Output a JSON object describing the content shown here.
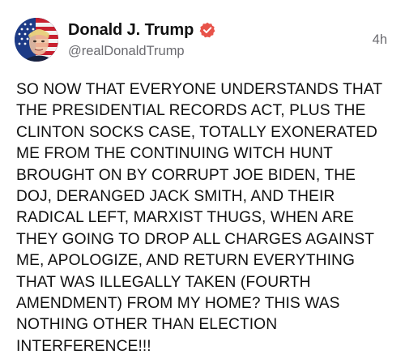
{
  "author": {
    "display_name": "Donald J. Trump",
    "handle": "@realDonaldTrump",
    "verified": true,
    "avatar_icon": "flag-portrait-avatar"
  },
  "timestamp": "4h",
  "post": {
    "lines": [
      "SO NOW THAT EVERYONE UNDERSTANDS THAT",
      "THE PRESIDENTIAL RECORDS ACT, PLUS THE",
      "CLINTON SOCKS CASE, TOTALLY EXONERATED",
      "ME FROM THE CONTINUING WITCH HUNT",
      "BROUGHT ON BY CORRUPT JOE BIDEN, THE",
      "DOJ, DERANGED JACK SMITH, AND THEIR",
      "RADICAL LEFT, MARXIST THUGS, WHEN ARE",
      "THEY GOING TO DROP ALL CHARGES AGAINST",
      "ME, APOLOGIZE, AND RETURN EVERYTHING",
      "THAT WAS ILLEGALLY TAKEN (FOURTH",
      "AMENDMENT) FROM MY HOME? THIS WAS",
      "NOTHING OTHER THAN ELECTION",
      "INTERFERENCE!!!"
    ]
  },
  "colors": {
    "text": "#111111",
    "secondary_text": "#6b6b70",
    "verified_badge": "#e8534a",
    "background": "#ffffff"
  }
}
